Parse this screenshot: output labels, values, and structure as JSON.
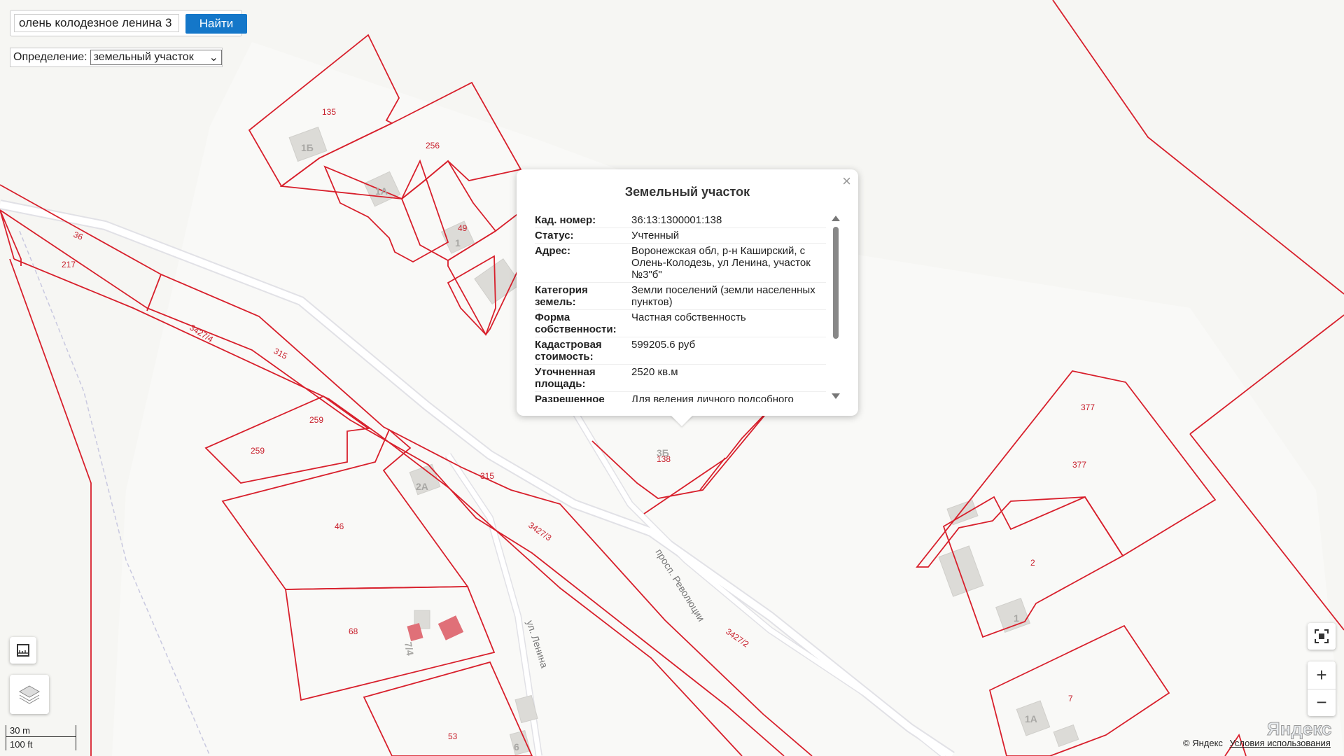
{
  "search": {
    "value": "олень колодезное ленина 3",
    "button": "Найти"
  },
  "definition": {
    "label": "Определение:",
    "selected": "земельный участок"
  },
  "popup": {
    "title": "Земельный участок",
    "rows": [
      {
        "key": "Кад. номер:",
        "value": "36:13:1300001:138"
      },
      {
        "key": "Статус:",
        "value": "Учтенный"
      },
      {
        "key": "Адрес:",
        "value": "Воронежская обл, р-н Каширский, с Олень-Колодезь, ул Ленина, участок №3\"б\""
      },
      {
        "key": "Категория земель:",
        "value": "Земли поселений (земли населенных пунктов)"
      },
      {
        "key": "Форма собственности:",
        "value": "Частная собственность"
      },
      {
        "key": "Кадастровая стоимость:",
        "value": "599205.6 руб"
      },
      {
        "key": "Уточненная площадь:",
        "value": "2520 кв.м"
      },
      {
        "key": "Разрешенное",
        "value": "Для ведения личного подсобного"
      }
    ]
  },
  "map": {
    "parcel_labels": [
      "135",
      "256",
      "49",
      "36",
      "217",
      "3427/4",
      "315",
      "259",
      "259",
      "46",
      "68",
      "53",
      "315",
      "3427/3",
      "3427/2",
      "138",
      "377",
      "377",
      "2",
      "7"
    ],
    "building_labels": [
      "1Б",
      "1А",
      "1",
      "2А",
      "7/4",
      "6",
      "1",
      "1А",
      "3Б"
    ],
    "street_labels": [
      "просп. Революции",
      "ул. Ленина"
    ]
  },
  "scale": {
    "metric": "30 m",
    "imperial": "100 ft"
  },
  "logo": "Яндекс",
  "copyright": "© Яндекс",
  "terms": "Условия использования",
  "colors": {
    "parcel_border": "#d8202c",
    "button": "#1477c9"
  }
}
